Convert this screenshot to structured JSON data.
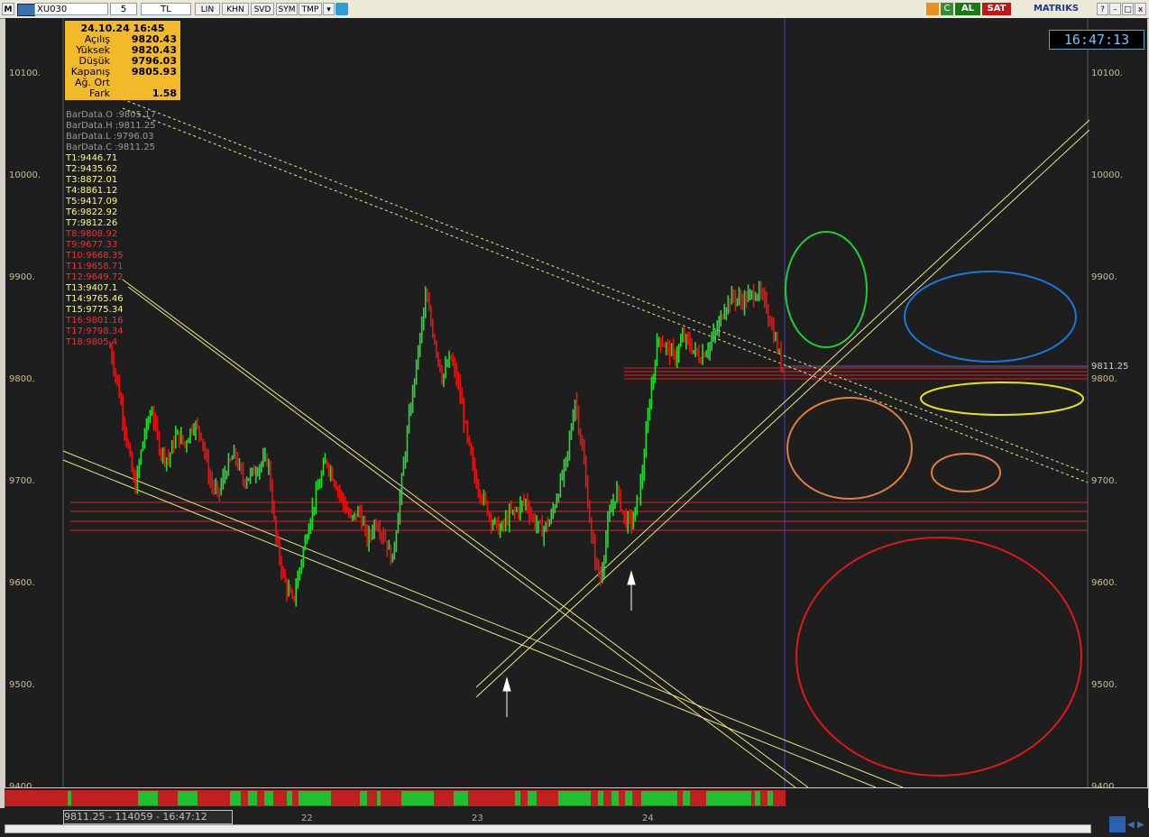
{
  "toolbar": {
    "m_label": "M",
    "symbol": "XU030",
    "period": "5",
    "currency": "TL",
    "buttons": [
      "LIN",
      "KHN",
      "SVD",
      "SYM",
      "TMP"
    ],
    "buy_label": "AL",
    "sell_label": "SAT",
    "brand": "MATRIKS",
    "win_controls": [
      "?",
      "–",
      "□",
      "x"
    ]
  },
  "clock": "16:47:13",
  "infobox": {
    "datetime": "24.10.24 16:45",
    "rows": [
      {
        "label": "Açılış",
        "value": "9820.43"
      },
      {
        "label": "Yüksek",
        "value": "9820.43"
      },
      {
        "label": "Düşük",
        "value": "9796.03"
      },
      {
        "label": "Kapanış",
        "value": "9805.93"
      },
      {
        "label": "Ağ. Ort",
        "value": ""
      },
      {
        "label": "Fark",
        "value": "1.58"
      }
    ]
  },
  "bardata": [
    "BarData.O :9805.17",
    "BarData.H :9811.25",
    "BarData.L :9796.03",
    "BarData.C :9811.25"
  ],
  "tlist": [
    {
      "text": "T1:9446.71",
      "color": "#ffff66"
    },
    {
      "text": "T2:9435.62",
      "color": "#ffff66"
    },
    {
      "text": "T3:8872.01",
      "color": "#ffff66"
    },
    {
      "text": "T4:8861.12",
      "color": "#ffff66"
    },
    {
      "text": "T5:9417.09",
      "color": "#ffff66"
    },
    {
      "text": "T6:9822.92",
      "color": "#ffff66"
    },
    {
      "text": "T7:9812.26",
      "color": "#ffff66"
    },
    {
      "text": "T8:9808.92",
      "color": "#ff2a2a"
    },
    {
      "text": "T9:9677.33",
      "color": "#ff2a2a"
    },
    {
      "text": "T10:9668.35",
      "color": "#ff2a2a"
    },
    {
      "text": "T11:9658.71",
      "color": "#ff2a2a"
    },
    {
      "text": "T12:9649.72",
      "color": "#ff2a2a"
    },
    {
      "text": "T13:9407.1",
      "color": "#ffff66"
    },
    {
      "text": "T14:9765.46",
      "color": "#ffff66"
    },
    {
      "text": "T15:9775.34",
      "color": "#ffff66"
    },
    {
      "text": "T16:9801.16",
      "color": "#ff2a2a"
    },
    {
      "text": "T17:9798.34",
      "color": "#ff2a2a"
    },
    {
      "text": "T18:9805.4",
      "color": "#ff2a2a"
    }
  ],
  "axis": {
    "left_ticks": [
      "10100.",
      "10000.",
      "9900.",
      "9800.",
      "9700.",
      "9600.",
      "9500.",
      "9400."
    ],
    "right_ticks": [
      "10100.",
      "10000.",
      "9900.",
      "9800.",
      "9700.",
      "9600.",
      "9500.",
      "9400."
    ],
    "last_price": "9811.25"
  },
  "dates": [
    "22",
    "23",
    "24"
  ],
  "readout": "9811.25 - 114059 - 16:47:12",
  "colors": {
    "up": "#22dd33",
    "down": "#ee1111",
    "trend": "#e8e880",
    "level": "#dd2222"
  },
  "chart_data": {
    "type": "line",
    "ylim": [
      9400,
      10150
    ],
    "series": [
      {
        "values": [
          9830,
          9790,
          9740,
          9690,
          9740,
          9770,
          9730,
          9720,
          9745,
          9735,
          9755,
          9745,
          9700,
          9685,
          9710,
          9725,
          9700,
          9705,
          9715,
          9720,
          9640,
          9600,
          9580,
          9620,
          9660,
          9690,
          9720,
          9700,
          9680,
          9660,
          9670,
          9640,
          9660,
          9645,
          9620,
          9690,
          9760,
          9820,
          9880,
          9840,
          9800,
          9820,
          9790,
          9740,
          9700,
          9680,
          9660,
          9650,
          9665,
          9670,
          9680,
          9660,
          9650,
          9660,
          9690,
          9720,
          9780,
          9720,
          9640,
          9600,
          9660,
          9690,
          9660,
          9660,
          9700,
          9780,
          9840,
          9830,
          9820,
          9840,
          9830,
          9820,
          9830,
          9845,
          9870,
          9880,
          9875,
          9880,
          9885,
          9870,
          9840,
          9808
        ]
      }
    ]
  }
}
